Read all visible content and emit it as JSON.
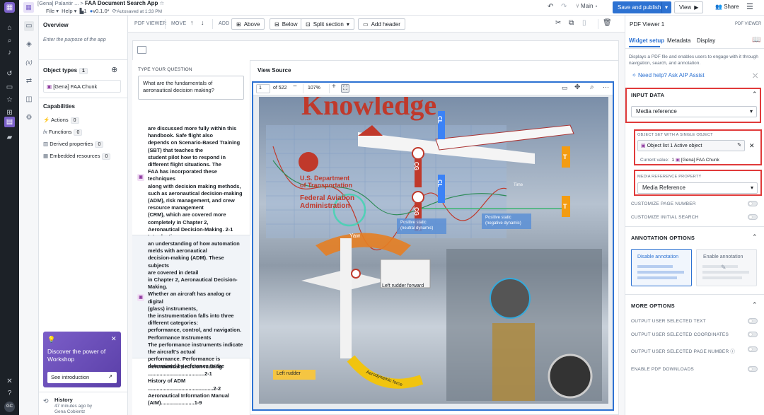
{
  "header": {
    "breadcrumb_parent": "[Gena] Palantir ...",
    "breadcrumb_sep": ">",
    "title": "FAA Document Search App",
    "menu_file": "File",
    "menu_help": "Help",
    "pages_count": "1",
    "version": "v0.1.0*",
    "autosave": "Autosaved at 1:33 PM",
    "branch": "Main",
    "save_publish": "Save and publish",
    "view": "View",
    "share": "Share"
  },
  "left_panel": {
    "overview_title": "Overview",
    "overview_placeholder": "Enter the purpose of the app",
    "object_types_title": "Object types",
    "object_types_count": "1",
    "object_type_item": "[Gena] FAA Chunk",
    "capabilities_title": "Capabilities",
    "capabilities": [
      {
        "label": "Actions",
        "count": "0"
      },
      {
        "label": "Functions",
        "count": "0"
      },
      {
        "label": "Derived properties",
        "count": "0"
      },
      {
        "label": "Embedded resources",
        "count": "0"
      }
    ],
    "promo_title": "Discover the power of Workshop",
    "promo_button": "See introduction",
    "history_title": "History",
    "history_time": "47 minutes ago by",
    "history_user": "Gena Cobientz"
  },
  "toolbar": {
    "pdf_viewer": "PDF VIEWER",
    "move": "MOVE",
    "add": "ADD",
    "above": "Above",
    "below": "Below",
    "split_section": "Split section",
    "add_header": "Add header"
  },
  "question": {
    "label": "TYPE YOUR QUESTION",
    "value": "What are the fundamentals of aeronautical decision making?"
  },
  "results": [
    {
      "text": "are discussed more fully within this\nhandbook. Safe flight also\ndepends on Scenario-Based Training\n(SBT) that teaches the\nstudent pilot how to respond in\ndifferent flight situations. The\nFAA has incorporated these techniques\nalong with decision making methods,\nsuch as aeronautical decision-making\n(ADM), risk management, and crew\nresource management\n(CRM), which are covered more\ncompletely in Chapter 2,\nAeronautical Decision-Making. 2-1\nIntroduction"
    },
    {
      "text": "an understanding of how automation\nmelds with aeronautical\ndecision-making (ADM). These subjects\nare covered in detail\nin Chapter 2, Aeronautical Decision-\nMaking.\nWhether an aircraft has analog or digital\n(glass) instruments,\nthe instrumentation falls into three\ndifferent categories:\nperformance, control, and navigation.\nPerformance Instruments\nThe performance instruments indicate\nthe aircraft's actual\nperformance. Performance is\ndetermined by reference to the"
    },
    {
      "text": "Aeronautical decision-making\n.......................................2-1\nHistory of ADM\n.............................................2-2\nAeronautical Information Manual\n(AIM).......................1-9"
    }
  ],
  "viewer": {
    "title": "View Source",
    "page": "1",
    "of_pages": "of 522",
    "zoom": "107%",
    "image_texts": {
      "heading": "Knowledge",
      "dot1": "U.S. Department",
      "dot2": "of Transportation",
      "faa1": "Federal Aviation",
      "faa2": "Administration",
      "yaw": "Yaw",
      "cl": "CL",
      "cg": "CG",
      "t": "T",
      "time": "Time",
      "positive_static": "Positive static",
      "negative_dynamic": "(negative dynamic)",
      "positive_static2": "Positive static",
      "neutral_dynamic": "(neutral dynamic)",
      "left_rudder_forward": "Left rudder forward",
      "left_rudder": "Left rudder",
      "aero_force": "Aerodynamic force"
    }
  },
  "right_panel": {
    "title": "PDF Viewer 1",
    "badge": "PDF VIEWER",
    "tabs": [
      "Widget setup",
      "Metadata",
      "Display"
    ],
    "description": "Displays a PDF file and enables users to engage with it through navigation, search, and annotation.",
    "help": "Need help? Ask AIP Assist",
    "input_data": "INPUT DATA",
    "input_select": "Media reference",
    "object_set_label": "OBJECT SET WITH A SINGLE OBJECT",
    "object_set_value": "Object list 1 Active object",
    "current_value_label": "Current value:",
    "current_value_num": "1",
    "current_value": "[Gena] FAA Chunk",
    "media_prop_label": "MEDIA REFERENCE PROPERTY",
    "media_prop_value": "Media Reference",
    "customize_page": "CUSTOMIZE PAGE NUMBER",
    "customize_search": "CUSTOMIZE INITIAL SEARCH",
    "annotation_options": "ANNOTATION OPTIONS",
    "disable_annotation": "Disable annotation",
    "enable_annotation": "Enable annotation",
    "more_options": "MORE OPTIONS",
    "out_text": "OUTPUT USER SELECTED TEXT",
    "out_coords": "OUTPUT USER SELECTED COORDINATES",
    "out_page": "OUTPUT USER SELECTED PAGE NUMBER",
    "enable_downloads": "ENABLE PDF DOWNLOADS"
  },
  "user_initials": "GC",
  "colors": {
    "accent": "#2d72d2",
    "highlight": "#e03a3a",
    "rail": "#1c2127"
  }
}
